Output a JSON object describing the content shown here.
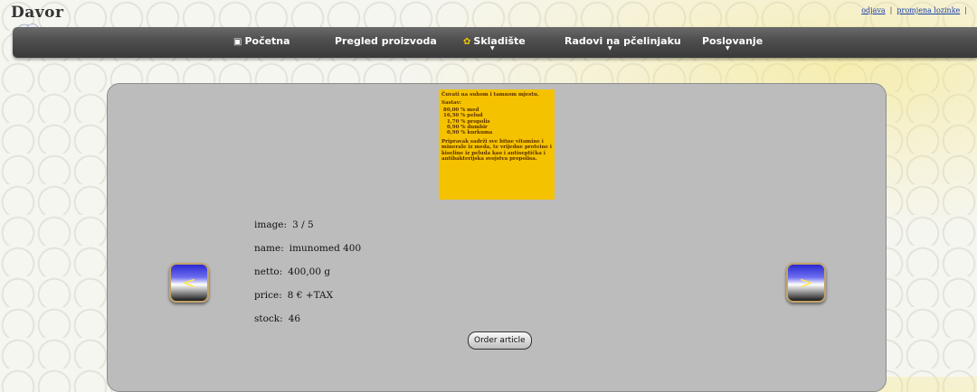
{
  "brand": "Davor",
  "top_links": {
    "logout": "odjava",
    "change_password": "promjena lozinke"
  },
  "nav": [
    {
      "label": "Početna",
      "icon": "home-icon",
      "has_submenu": false
    },
    {
      "label": "Pregled proizvoda",
      "icon": "",
      "has_submenu": false
    },
    {
      "label": "Skladište",
      "icon": "honey-icon",
      "has_submenu": true
    },
    {
      "label": "Radovi na pčelinjaku",
      "icon": "",
      "has_submenu": true
    },
    {
      "label": "Poslovanje",
      "icon": "",
      "has_submenu": true
    }
  ],
  "label_card": {
    "heading": "Čuvati na suhom i tamnom mjestu.",
    "composition_title": "Sastav:",
    "ingredients": [
      "80,00 % med",
      "16,50 % pelud"
    ],
    "sub_ingredients": [
      "1,70 % propolis",
      "0,90 % dumbir",
      "0,90 % kurkuma"
    ],
    "description": "Pripravak sadrži sve bitne vitamine i minerale iz meda, te vrijedne proteine i kiseline iz peluda kao i antiseptička i antibakterijska svojstva propolisa."
  },
  "product": {
    "image_label": "image:",
    "image_value": "3 / 5",
    "name_label": "name:",
    "name_value": "imunomed 400",
    "netto_label": "netto:",
    "netto_value": "400,00 g",
    "price_label": "price:",
    "price_value": "8 € +TAX",
    "stock_label": "stock:",
    "stock_value": "46"
  },
  "prev_glyph": "<",
  "next_glyph": ">",
  "order_button": "Order article",
  "colors": {
    "navbar": "#4d4d4d",
    "panel": "#bcbcbc",
    "label_bg": "#f5c200",
    "arrow_glyph": "#ffe84a"
  }
}
